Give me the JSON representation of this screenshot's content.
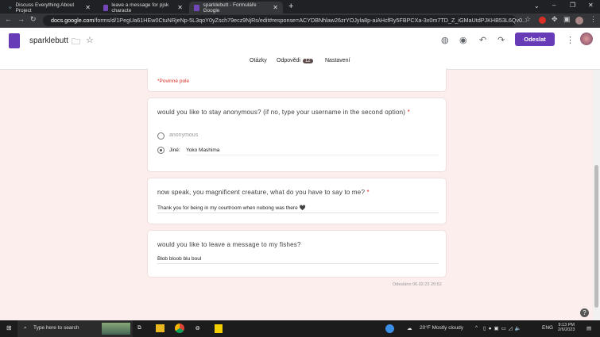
{
  "browser": {
    "tabs": [
      {
        "title": "Discuss Everything About Project"
      },
      {
        "title": "leave a message for pjsk characte"
      },
      {
        "title": "sparklebutt - Formuláře Google"
      }
    ],
    "url_host": "docs.google.com",
    "url_path": "/forms/d/1PegUa61HEw0CtuNRjeNp-5L3qoY0yZsch79ecz9NjRs/edit#response=ACYDBNhlaw26zrYOJyla8p-aiAHcfRy5FBPCXa-3x0m7TD_Z_iGMaUtdPJKHB53L6Qv0..."
  },
  "form": {
    "title": "sparklebutt",
    "send_label": "Odeslat",
    "tabs": [
      {
        "label": "Otázky"
      },
      {
        "label": "Odpovědi",
        "badge": "12"
      },
      {
        "label": "Nastavení"
      }
    ],
    "required_note": "*Povinné pole",
    "questions": [
      {
        "text": "would you like to stay anonymous? (if no, type your username in the second option)",
        "required": "*",
        "options": [
          "anonymous",
          "Jiné:"
        ],
        "other_value": "Yoko Mashima"
      },
      {
        "text": "now speak, you magnificent creature, what do you have to say to me?",
        "required": "*",
        "answer": "Thank you for being in my courtroom when nobong was there 🖤"
      },
      {
        "text": "would you like to leave a message to my fishes?",
        "answer": "Blob bloob blu boul"
      }
    ],
    "submitted": "Odesláno 06.02.23 20:52"
  },
  "taskbar": {
    "search_placeholder": "Type here to search",
    "weather": "20°F  Mostly cloudy",
    "lang": "ENG",
    "time": "9:13 PM",
    "date": "2/6/2023"
  },
  "colors": {
    "accent": "#673ab7",
    "background": "#fdeeee"
  }
}
